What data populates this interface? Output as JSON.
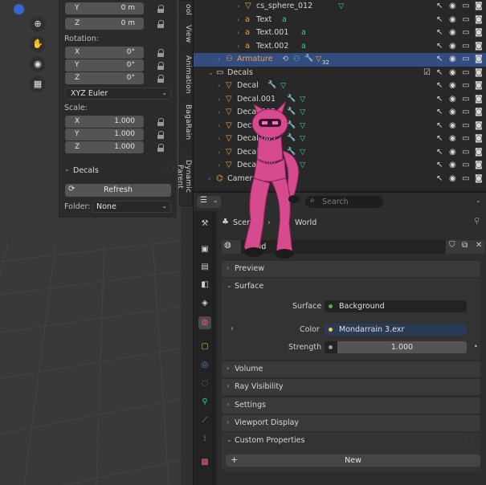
{
  "npanel": {
    "top_axes": [
      {
        "axis": "Y",
        "value": "0 m"
      },
      {
        "axis": "Z",
        "value": "0 m"
      }
    ],
    "rotation_label": "Rotation:",
    "rotation": [
      {
        "axis": "X",
        "value": "0°"
      },
      {
        "axis": "Y",
        "value": "0°"
      },
      {
        "axis": "Z",
        "value": "0°"
      }
    ],
    "rotation_mode": "XYZ Euler",
    "scale_label": "Scale:",
    "scale": [
      {
        "axis": "X",
        "value": "1.000"
      },
      {
        "axis": "Y",
        "value": "1.000"
      },
      {
        "axis": "Z",
        "value": "1.000"
      }
    ],
    "decals_header": "Decals",
    "refresh_label": "Refresh",
    "folder_label": "Folder:",
    "folder_value": "None"
  },
  "side_tabs": [
    "ool",
    "View",
    "Animation",
    "BagaRain",
    "Dynamic Parent"
  ],
  "outliner": {
    "rows": [
      {
        "name": "cs_sphere_012",
        "kind": "mesh",
        "indent": 4
      },
      {
        "name": "Text",
        "kind": "text",
        "indent": 4
      },
      {
        "name": "Text.001",
        "kind": "text",
        "indent": 4
      },
      {
        "name": "Text.002",
        "kind": "text",
        "indent": 4
      },
      {
        "name": "Armature",
        "kind": "armature",
        "indent": 2,
        "selected": true,
        "badge": "32"
      },
      {
        "name": "Decals",
        "kind": "collection",
        "indent": 1
      },
      {
        "name": "Decal",
        "kind": "mesh",
        "indent": 2
      },
      {
        "name": "Decal.001",
        "kind": "mesh",
        "indent": 2
      },
      {
        "name": "Decal.002",
        "kind": "mesh",
        "indent": 2
      },
      {
        "name": "Decal.003",
        "kind": "mesh",
        "indent": 2
      },
      {
        "name": "Decal.005",
        "kind": "mesh",
        "indent": 2
      },
      {
        "name": "Decal.006",
        "kind": "mesh",
        "indent": 2
      },
      {
        "name": "Decal.008",
        "kind": "mesh",
        "indent": 2
      },
      {
        "name": "Camera",
        "kind": "camera",
        "indent": 1
      }
    ]
  },
  "properties": {
    "search_placeholder": "Search",
    "breadcrumb_scene": "Scene",
    "breadcrumb_world": "World",
    "world_name": "World",
    "sections": {
      "preview": "Preview",
      "surface": "Surface",
      "volume": "Volume",
      "ray_visibility": "Ray Visibility",
      "settings": "Settings",
      "viewport_display": "Viewport Display",
      "custom_properties": "Custom Properties"
    },
    "surface_label": "Surface",
    "surface_value": "Background",
    "color_label": "Color",
    "color_value": "Mondarrain 3.exr",
    "strength_label": "Strength",
    "strength_value": "1.000",
    "new_label": "New"
  },
  "colors": {
    "accent_selected": "#334d80",
    "armature_orange": "#e8a34a",
    "modifier_blue": "#5a8ed0",
    "mesh_green": "#3fc79a",
    "character_pink": "#e0448f"
  }
}
